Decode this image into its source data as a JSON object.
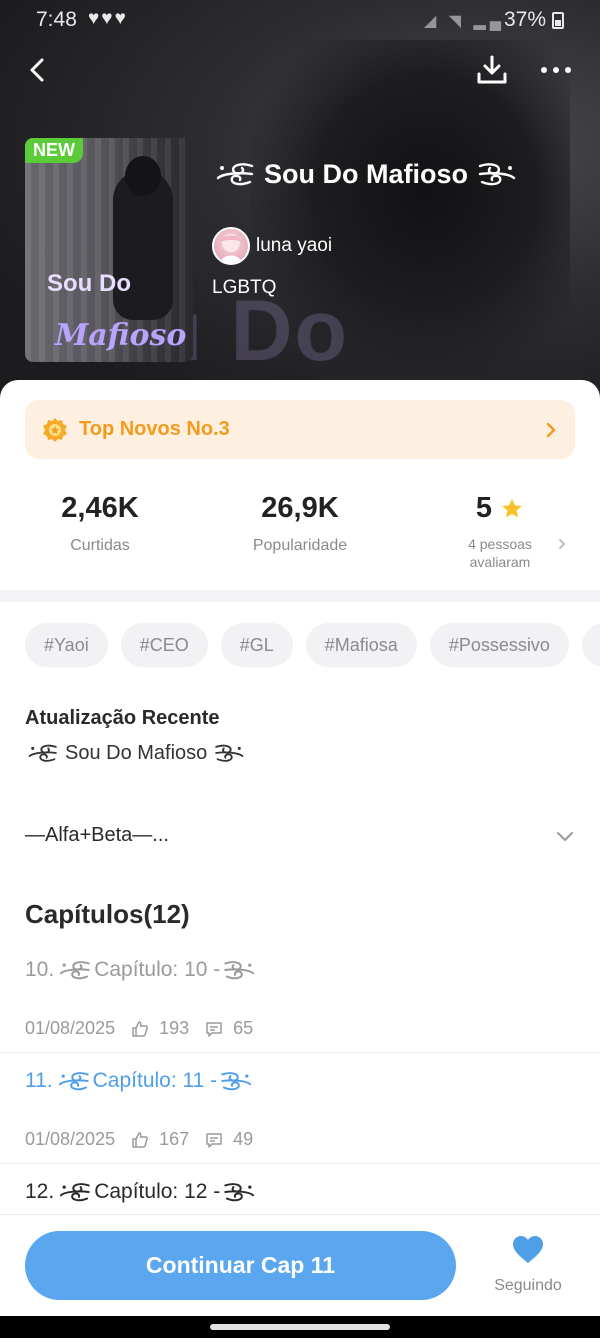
{
  "status_bar": {
    "time": "7:48",
    "hearts": "♥♥♥",
    "battery": "37%"
  },
  "book": {
    "badge": "NEW",
    "cover_title_line1": "Sou Do",
    "cover_title_line2": "Mafioso",
    "hero_watermark_a": "u ",
    "hero_watermark_b": "Do",
    "title": "Sou Do Mafioso",
    "author": "luna yaoi",
    "genre": "LGBTQ"
  },
  "ranking": {
    "label": "Top Novos No.3"
  },
  "stats": {
    "likes_value": "2,46K",
    "likes_label": "Curtidas",
    "popularity_value": "26,9K",
    "popularity_label": "Popularidade",
    "rating_value": "5",
    "rating_label_line1": "4 pessoas",
    "rating_label_line2": "avaliaram"
  },
  "tags": [
    "#Yaoi",
    "#CEO",
    "#GL",
    "#Mafiosa",
    "#Possessivo",
    "#"
  ],
  "recent": {
    "heading": "Atualização Recente",
    "value": "Sou Do Mafioso"
  },
  "description": {
    "text": "—Alfa+Beta—..."
  },
  "chapters": {
    "heading": "Capítulos(12)",
    "items": [
      {
        "num": "10.",
        "title": "Capítulo: 10 -",
        "date": "01/08/2025",
        "likes": "193",
        "comments": "65"
      },
      {
        "num": "11.",
        "title": "Capítulo: 11 -",
        "date": "01/08/2025",
        "likes": "167",
        "comments": "49"
      },
      {
        "num": "12.",
        "title": "Capítulo: 12 -"
      }
    ]
  },
  "bottom": {
    "continue_label": "Continuar Cap 11",
    "follow_label": "Seguindo"
  },
  "colors": {
    "accent": "#5aa6ef",
    "rank_text": "#f59b1c",
    "new_badge": "#5ccb3a",
    "active_chapter": "#4f9ee8",
    "star": "#fbc02d"
  }
}
